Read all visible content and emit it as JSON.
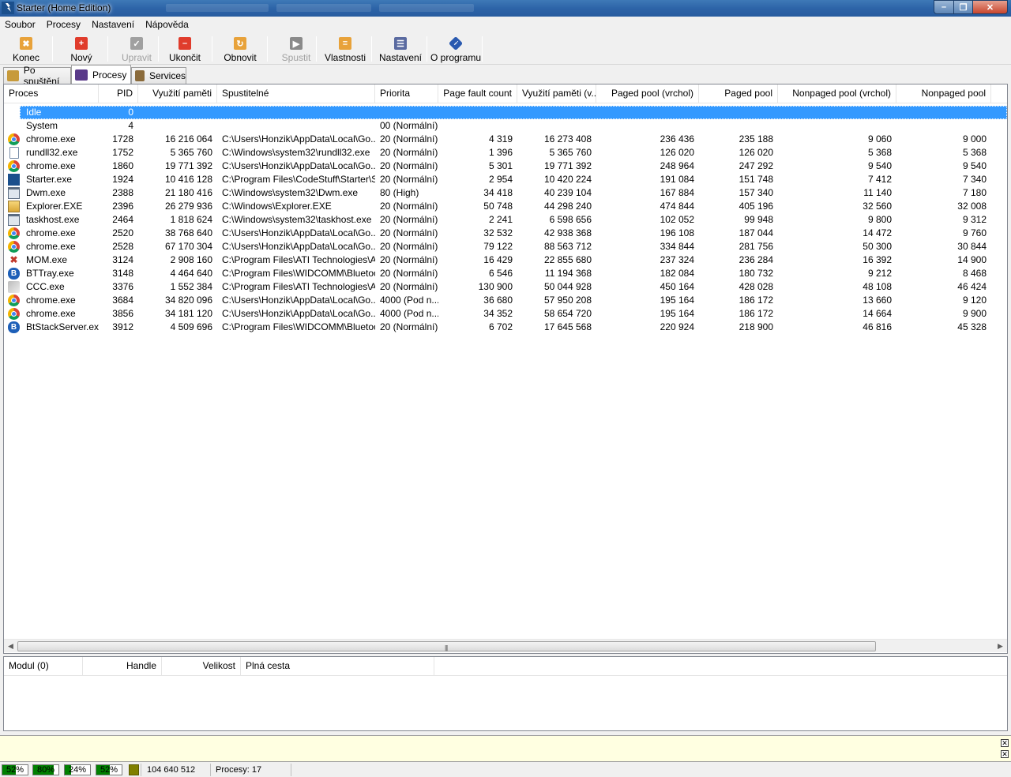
{
  "window": {
    "title": "Starter (Home Edition)"
  },
  "menu": [
    "Soubor",
    "Procesy",
    "Nastavení",
    "Nápověda"
  ],
  "toolbar": [
    {
      "label": "Konec",
      "icon": "exit-icon",
      "disabled": false,
      "color": "#e8a23a"
    },
    {
      "label": "Nový",
      "icon": "new-icon",
      "disabled": false,
      "color": "#e03c2c"
    },
    {
      "label": "Upravit",
      "icon": "check-icon",
      "disabled": true,
      "color": "#a0a0a0"
    },
    {
      "label": "Ukončit",
      "icon": "stop-icon",
      "disabled": false,
      "color": "#e03c2c"
    },
    {
      "label": "Obnovit",
      "icon": "refresh-icon",
      "disabled": false,
      "color": "#e8a23a"
    },
    {
      "label": "Spustit",
      "icon": "play-icon",
      "disabled": true,
      "color": "#8a8a8a"
    },
    {
      "label": "Vlastnosti",
      "icon": "properties-icon",
      "disabled": false,
      "color": "#e8a23a"
    },
    {
      "label": "Nastavení",
      "icon": "settings-icon",
      "disabled": false,
      "color": "#5a6aa0"
    },
    {
      "label": "O programu",
      "icon": "info-icon",
      "disabled": false,
      "color": "#2a5ab0"
    }
  ],
  "tabs": [
    {
      "label": "Po spuštění",
      "icon": "startup-icon",
      "active": false
    },
    {
      "label": "Procesy",
      "icon": "processes-icon",
      "active": true
    },
    {
      "label": "Services",
      "icon": "services-icon",
      "active": false
    }
  ],
  "process_columns": [
    "Proces",
    "PID",
    "Využití paměti",
    "Spustitelné",
    "Priorita",
    "Page fault count",
    "Využití paměti (v...",
    "Paged pool (vrchol)",
    "Paged pool",
    "Nonpaged pool (vrchol)",
    "Nonpaged pool"
  ],
  "processes": [
    {
      "icon": "none",
      "name": "Idle",
      "pid": "0",
      "mem": "",
      "exe": "",
      "prio": "",
      "pf": "",
      "memv": "",
      "ppv": "",
      "pp": "",
      "npv": "",
      "np": "",
      "selected": true
    },
    {
      "icon": "none",
      "name": "System",
      "pid": "4",
      "mem": "",
      "exe": "",
      "prio": "00 (Normální)",
      "pf": "",
      "memv": "",
      "ppv": "",
      "pp": "",
      "npv": "",
      "np": ""
    },
    {
      "icon": "chrome",
      "name": "chrome.exe",
      "pid": "1728",
      "mem": "16 216 064",
      "exe": "C:\\Users\\Honzik\\AppData\\Local\\Go...",
      "prio": "20 (Normální)",
      "pf": "4 319",
      "memv": "16 273 408",
      "ppv": "236 436",
      "pp": "235 188",
      "npv": "9 060",
      "np": "9 000"
    },
    {
      "icon": "doc",
      "name": "rundll32.exe",
      "pid": "1752",
      "mem": "5 365 760",
      "exe": "C:\\Windows\\system32\\rundll32.exe",
      "prio": "20 (Normální)",
      "pf": "1 396",
      "memv": "5 365 760",
      "ppv": "126 020",
      "pp": "126 020",
      "npv": "5 368",
      "np": "5 368"
    },
    {
      "icon": "chrome",
      "name": "chrome.exe",
      "pid": "1860",
      "mem": "19 771 392",
      "exe": "C:\\Users\\Honzik\\AppData\\Local\\Go...",
      "prio": "20 (Normální)",
      "pf": "5 301",
      "memv": "19 771 392",
      "ppv": "248 964",
      "pp": "247 292",
      "npv": "9 540",
      "np": "9 540"
    },
    {
      "icon": "starter",
      "name": "Starter.exe",
      "pid": "1924",
      "mem": "10 416 128",
      "exe": "C:\\Program Files\\CodeStuff\\Starter\\S...",
      "prio": "20 (Normální)",
      "pf": "2 954",
      "memv": "10 420 224",
      "ppv": "191 084",
      "pp": "151 748",
      "npv": "7 412",
      "np": "7 340"
    },
    {
      "icon": "window",
      "name": "Dwm.exe",
      "pid": "2388",
      "mem": "21 180 416",
      "exe": "C:\\Windows\\system32\\Dwm.exe",
      "prio": "80 (High)",
      "pf": "34 418",
      "memv": "40 239 104",
      "ppv": "167 884",
      "pp": "157 340",
      "npv": "11 140",
      "np": "7 180"
    },
    {
      "icon": "explorer",
      "name": "Explorer.EXE",
      "pid": "2396",
      "mem": "26 279 936",
      "exe": "C:\\Windows\\Explorer.EXE",
      "prio": "20 (Normální)",
      "pf": "50 748",
      "memv": "44 298 240",
      "ppv": "474 844",
      "pp": "405 196",
      "npv": "32 560",
      "np": "32 008"
    },
    {
      "icon": "window",
      "name": "taskhost.exe",
      "pid": "2464",
      "mem": "1 818 624",
      "exe": "C:\\Windows\\system32\\taskhost.exe",
      "prio": "20 (Normální)",
      "pf": "2 241",
      "memv": "6 598 656",
      "ppv": "102 052",
      "pp": "99 948",
      "npv": "9 800",
      "np": "9 312"
    },
    {
      "icon": "chrome",
      "name": "chrome.exe",
      "pid": "2520",
      "mem": "38 768 640",
      "exe": "C:\\Users\\Honzik\\AppData\\Local\\Go...",
      "prio": "20 (Normální)",
      "pf": "32 532",
      "memv": "42 938 368",
      "ppv": "196 108",
      "pp": "187 044",
      "npv": "14 472",
      "np": "9 760"
    },
    {
      "icon": "chrome",
      "name": "chrome.exe",
      "pid": "2528",
      "mem": "67 170 304",
      "exe": "C:\\Users\\Honzik\\AppData\\Local\\Go...",
      "prio": "20 (Normální)",
      "pf": "79 122",
      "memv": "88 563 712",
      "ppv": "334 844",
      "pp": "281 756",
      "npv": "50 300",
      "np": "30 844"
    },
    {
      "icon": "mom",
      "name": "MOM.exe",
      "pid": "3124",
      "mem": "2 908 160",
      "exe": "C:\\Program Files\\ATI Technologies\\A...",
      "prio": "20 (Normální)",
      "pf": "16 429",
      "memv": "22 855 680",
      "ppv": "237 324",
      "pp": "236 284",
      "npv": "16 392",
      "np": "14 900"
    },
    {
      "icon": "bt",
      "name": "BTTray.exe",
      "pid": "3148",
      "mem": "4 464 640",
      "exe": "C:\\Program Files\\WIDCOMM\\Bluetoo...",
      "prio": "20 (Normální)",
      "pf": "6 546",
      "memv": "11 194 368",
      "ppv": "182 084",
      "pp": "180 732",
      "npv": "9 212",
      "np": "8 468"
    },
    {
      "icon": "ccc",
      "name": "CCC.exe",
      "pid": "3376",
      "mem": "1 552 384",
      "exe": "C:\\Program Files\\ATI Technologies\\A...",
      "prio": "20 (Normální)",
      "pf": "130 900",
      "memv": "50 044 928",
      "ppv": "450 164",
      "pp": "428 028",
      "npv": "48 108",
      "np": "46 424"
    },
    {
      "icon": "chrome",
      "name": "chrome.exe",
      "pid": "3684",
      "mem": "34 820 096",
      "exe": "C:\\Users\\Honzik\\AppData\\Local\\Go...",
      "prio": "4000 (Pod n...",
      "pf": "36 680",
      "memv": "57 950 208",
      "ppv": "195 164",
      "pp": "186 172",
      "npv": "13 660",
      "np": "9 120"
    },
    {
      "icon": "chrome",
      "name": "chrome.exe",
      "pid": "3856",
      "mem": "34 181 120",
      "exe": "C:\\Users\\Honzik\\AppData\\Local\\Go...",
      "prio": "4000 (Pod n...",
      "pf": "34 352",
      "memv": "58 654 720",
      "ppv": "195 164",
      "pp": "186 172",
      "npv": "14 664",
      "np": "9 900"
    },
    {
      "icon": "bt",
      "name": "BtStackServer.exe",
      "pid": "3912",
      "mem": "4 509 696",
      "exe": "C:\\Program Files\\WIDCOMM\\Bluetoo...",
      "prio": "20 (Normální)",
      "pf": "6 702",
      "memv": "17 645 568",
      "ppv": "220 924",
      "pp": "218 900",
      "npv": "46 816",
      "np": "45 328"
    }
  ],
  "module_columns": [
    "Modul (0)",
    "Handle",
    "Velikost",
    "Plná cesta"
  ],
  "status": {
    "meters": [
      {
        "label": "52%",
        "value": 52
      },
      {
        "label": "80%",
        "value": 80
      },
      {
        "label": "24%",
        "value": 24
      },
      {
        "label": "52%",
        "value": 52
      }
    ],
    "memory": "104 640 512",
    "processes": "Procesy: 17"
  }
}
